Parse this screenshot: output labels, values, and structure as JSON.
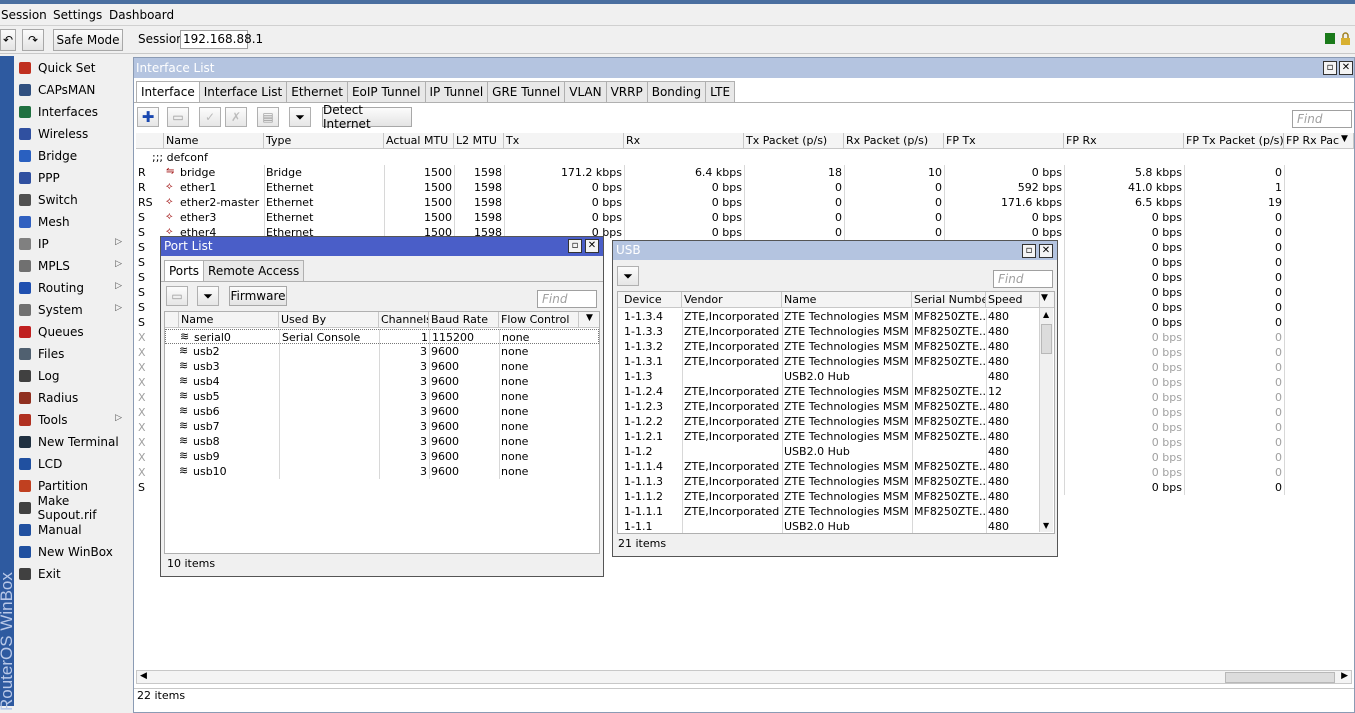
{
  "menu": {
    "session": "Session",
    "settings": "Settings",
    "dashboard": "Dashboard"
  },
  "toolbar": {
    "safe_mode": "Safe Mode",
    "session_label": "Session:",
    "session_value": "192.168.88.1"
  },
  "brand": "RouterOS WinBox",
  "sidebar": [
    {
      "label": "Quick Set",
      "icon": "wand-icon",
      "arrow": false
    },
    {
      "label": "CAPsMAN",
      "icon": "antenna-icon",
      "arrow": false
    },
    {
      "label": "Interfaces",
      "icon": "interfaces-icon",
      "arrow": false
    },
    {
      "label": "Wireless",
      "icon": "wireless-icon",
      "arrow": false
    },
    {
      "label": "Bridge",
      "icon": "bridge-icon",
      "arrow": false
    },
    {
      "label": "PPP",
      "icon": "ppp-icon",
      "arrow": false
    },
    {
      "label": "Switch",
      "icon": "switch-icon",
      "arrow": false
    },
    {
      "label": "Mesh",
      "icon": "mesh-icon",
      "arrow": false
    },
    {
      "label": "IP",
      "icon": "ip-icon",
      "arrow": true
    },
    {
      "label": "MPLS",
      "icon": "mpls-icon",
      "arrow": true
    },
    {
      "label": "Routing",
      "icon": "routing-icon",
      "arrow": true
    },
    {
      "label": "System",
      "icon": "gear-icon",
      "arrow": true
    },
    {
      "label": "Queues",
      "icon": "queues-icon",
      "arrow": false
    },
    {
      "label": "Files",
      "icon": "folder-icon",
      "arrow": false
    },
    {
      "label": "Log",
      "icon": "log-icon",
      "arrow": false
    },
    {
      "label": "Radius",
      "icon": "radius-icon",
      "arrow": false
    },
    {
      "label": "Tools",
      "icon": "tools-icon",
      "arrow": true
    },
    {
      "label": "New Terminal",
      "icon": "terminal-icon",
      "arrow": false
    },
    {
      "label": "LCD",
      "icon": "lcd-icon",
      "arrow": false
    },
    {
      "label": "Partition",
      "icon": "partition-icon",
      "arrow": false
    },
    {
      "label": "Make Supout.rif",
      "icon": "supout-icon",
      "arrow": false
    },
    {
      "label": "Manual",
      "icon": "help-icon",
      "arrow": false
    },
    {
      "label": "New WinBox",
      "icon": "winbox-icon",
      "arrow": false
    },
    {
      "label": "Exit",
      "icon": "exit-icon",
      "arrow": false
    }
  ],
  "interface_list": {
    "title": "Interface List",
    "tabs": [
      "Interface",
      "Interface List",
      "Ethernet",
      "EoIP Tunnel",
      "IP Tunnel",
      "GRE Tunnel",
      "VLAN",
      "VRRP",
      "Bonding",
      "LTE"
    ],
    "detect_internet": "Detect Internet",
    "find_placeholder": "Find",
    "columns": [
      "Name",
      "Type",
      "Actual MTU",
      "L2 MTU",
      "Tx",
      "Rx",
      "Tx Packet (p/s)",
      "Rx Packet (p/s)",
      "FP Tx",
      "FP Rx",
      "FP Tx Packet (p/s)",
      "FP Rx Pac"
    ],
    "group_label": ";;; defconf",
    "rows": [
      {
        "flag": "R",
        "name": "bridge",
        "type": "Bridge",
        "mtu": "1500",
        "l2mtu": "1598",
        "tx": "171.2 kbps",
        "rx": "6.4 kbps",
        "txp": "18",
        "rxp": "10",
        "fptx": "0 bps",
        "fprx": "5.8 kbps",
        "fptxp": "0"
      },
      {
        "flag": "R",
        "name": "ether1",
        "type": "Ethernet",
        "mtu": "1500",
        "l2mtu": "1598",
        "tx": "0 bps",
        "rx": "0 bps",
        "txp": "0",
        "rxp": "0",
        "fptx": "592 bps",
        "fprx": "41.0 kbps",
        "fptxp": "1"
      },
      {
        "flag": "RS",
        "name": "ether2-master",
        "type": "Ethernet",
        "mtu": "1500",
        "l2mtu": "1598",
        "tx": "0 bps",
        "rx": "0 bps",
        "txp": "0",
        "rxp": "0",
        "fptx": "171.6 kbps",
        "fprx": "6.5 kbps",
        "fptxp": "19"
      },
      {
        "flag": "S",
        "name": "ether3",
        "type": "Ethernet",
        "mtu": "1500",
        "l2mtu": "1598",
        "tx": "0 bps",
        "rx": "0 bps",
        "txp": "0",
        "rxp": "0",
        "fptx": "0 bps",
        "fprx": "0 bps",
        "fptxp": "0"
      },
      {
        "flag": "S",
        "name": "ether4",
        "type": "Ethernet",
        "mtu": "1500",
        "l2mtu": "1598",
        "tx": "0 bps",
        "rx": "0 bps",
        "txp": "0",
        "rxp": "0",
        "fptx": "0 bps",
        "fprx": "0 bps",
        "fptxp": "0"
      }
    ],
    "hidden_rows": [
      {
        "flag": "S",
        "fprx": "0 bps",
        "fptxp": "0",
        "dim": false
      },
      {
        "flag": "S",
        "fprx": "0 bps",
        "fptxp": "0",
        "dim": false
      },
      {
        "flag": "S",
        "fprx": "0 bps",
        "fptxp": "0",
        "dim": false
      },
      {
        "flag": "S",
        "fprx": "0 bps",
        "fptxp": "0",
        "dim": false
      },
      {
        "flag": "S",
        "fprx": "0 bps",
        "fptxp": "0",
        "dim": false
      },
      {
        "flag": "S",
        "fprx": "0 bps",
        "fptxp": "0",
        "dim": false
      },
      {
        "flag": "X",
        "fprx": "0 bps",
        "fptxp": "0",
        "dim": true
      },
      {
        "flag": "X",
        "fprx": "0 bps",
        "fptxp": "0",
        "dim": true
      },
      {
        "flag": "X",
        "fprx": "0 bps",
        "fptxp": "0",
        "dim": true
      },
      {
        "flag": "X",
        "fprx": "0 bps",
        "fptxp": "0",
        "dim": true
      },
      {
        "flag": "X",
        "fprx": "0 bps",
        "fptxp": "0",
        "dim": true
      },
      {
        "flag": "X",
        "fprx": "0 bps",
        "fptxp": "0",
        "dim": true
      },
      {
        "flag": "X",
        "fprx": "0 bps",
        "fptxp": "0",
        "dim": true
      },
      {
        "flag": "X",
        "fprx": "0 bps",
        "fptxp": "0",
        "dim": true
      },
      {
        "flag": "X",
        "fprx": "0 bps",
        "fptxp": "0",
        "dim": true
      },
      {
        "flag": "X",
        "fprx": "0 bps",
        "fptxp": "0",
        "dim": true
      },
      {
        "flag": "S",
        "fprx": "0 bps",
        "fptxp": "0",
        "dim": false
      }
    ],
    "status": "22 items"
  },
  "port_list": {
    "title": "Port List",
    "tabs": [
      "Ports",
      "Remote Access"
    ],
    "firmware": "Firmware",
    "find_placeholder": "Find",
    "columns": [
      "Name",
      "Used By",
      "Channels",
      "Baud Rate",
      "Flow Control"
    ],
    "rows": [
      {
        "name": "serial0",
        "used_by": "Serial Console",
        "channels": "1",
        "baud": "115200",
        "flow": "none"
      },
      {
        "name": "usb2",
        "used_by": "",
        "channels": "3",
        "baud": "9600",
        "flow": "none"
      },
      {
        "name": "usb3",
        "used_by": "",
        "channels": "3",
        "baud": "9600",
        "flow": "none"
      },
      {
        "name": "usb4",
        "used_by": "",
        "channels": "3",
        "baud": "9600",
        "flow": "none"
      },
      {
        "name": "usb5",
        "used_by": "",
        "channels": "3",
        "baud": "9600",
        "flow": "none"
      },
      {
        "name": "usb6",
        "used_by": "",
        "channels": "3",
        "baud": "9600",
        "flow": "none"
      },
      {
        "name": "usb7",
        "used_by": "",
        "channels": "3",
        "baud": "9600",
        "flow": "none"
      },
      {
        "name": "usb8",
        "used_by": "",
        "channels": "3",
        "baud": "9600",
        "flow": "none"
      },
      {
        "name": "usb9",
        "used_by": "",
        "channels": "3",
        "baud": "9600",
        "flow": "none"
      },
      {
        "name": "usb10",
        "used_by": "",
        "channels": "3",
        "baud": "9600",
        "flow": "none"
      }
    ],
    "status": "10 items"
  },
  "usb": {
    "title": "USB",
    "find_placeholder": "Find",
    "columns": [
      "Device",
      "Vendor",
      "Name",
      "Serial Number",
      "Speed"
    ],
    "rows": [
      {
        "device": "1-1.3.4",
        "vendor": "ZTE,Incorporated",
        "name": "ZTE Technologies MSM",
        "serial": "MF8250ZTE...",
        "speed": "480"
      },
      {
        "device": "1-1.3.3",
        "vendor": "ZTE,Incorporated",
        "name": "ZTE Technologies MSM",
        "serial": "MF8250ZTE...",
        "speed": "480"
      },
      {
        "device": "1-1.3.2",
        "vendor": "ZTE,Incorporated",
        "name": "ZTE Technologies MSM",
        "serial": "MF8250ZTE...",
        "speed": "480"
      },
      {
        "device": "1-1.3.1",
        "vendor": "ZTE,Incorporated",
        "name": "ZTE Technologies MSM",
        "serial": "MF8250ZTE...",
        "speed": "480"
      },
      {
        "device": "1-1.3",
        "vendor": "",
        "name": "USB2.0 Hub",
        "serial": "",
        "speed": "480"
      },
      {
        "device": "1-1.2.4",
        "vendor": "ZTE,Incorporated",
        "name": "ZTE Technologies MSM",
        "serial": "MF8250ZTE...",
        "speed": "12"
      },
      {
        "device": "1-1.2.3",
        "vendor": "ZTE,Incorporated",
        "name": "ZTE Technologies MSM",
        "serial": "MF8250ZTE...",
        "speed": "480"
      },
      {
        "device": "1-1.2.2",
        "vendor": "ZTE,Incorporated",
        "name": "ZTE Technologies MSM",
        "serial": "MF8250ZTE...",
        "speed": "480"
      },
      {
        "device": "1-1.2.1",
        "vendor": "ZTE,Incorporated",
        "name": "ZTE Technologies MSM",
        "serial": "MF8250ZTE...",
        "speed": "480"
      },
      {
        "device": "1-1.2",
        "vendor": "",
        "name": "USB2.0 Hub",
        "serial": "",
        "speed": "480"
      },
      {
        "device": "1-1.1.4",
        "vendor": "ZTE,Incorporated",
        "name": "ZTE Technologies MSM",
        "serial": "MF8250ZTE...",
        "speed": "480"
      },
      {
        "device": "1-1.1.3",
        "vendor": "ZTE,Incorporated",
        "name": "ZTE Technologies MSM",
        "serial": "MF8250ZTE...",
        "speed": "480"
      },
      {
        "device": "1-1.1.2",
        "vendor": "ZTE,Incorporated",
        "name": "ZTE Technologies MSM",
        "serial": "MF8250ZTE...",
        "speed": "480"
      },
      {
        "device": "1-1.1.1",
        "vendor": "ZTE,Incorporated",
        "name": "ZTE Technologies MSM",
        "serial": "MF8250ZTE...",
        "speed": "480"
      },
      {
        "device": "1-1.1",
        "vendor": "",
        "name": "USB2.0 Hub",
        "serial": "",
        "speed": "480"
      }
    ],
    "status": "21 items"
  },
  "colors": {
    "brand": "#2e5aa0",
    "active_title": "#4a5ec8",
    "inactive_title": "#b4c4e0"
  }
}
